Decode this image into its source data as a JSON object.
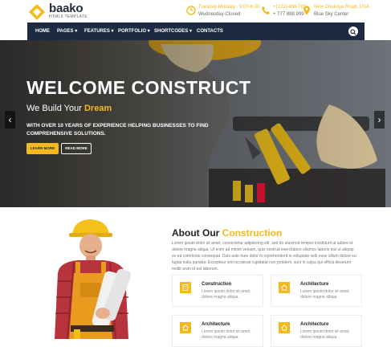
{
  "brand": {
    "name": "baako",
    "tagline": "HTML5 TEMPLATE",
    "accent": "#f5b91e",
    "navy": "#1c2a42"
  },
  "contact": [
    {
      "icon": "clock-icon",
      "line1": "Tuesday-Monday : 9:00-6.00",
      "line2": "Wednesday-Closed"
    },
    {
      "icon": "phone-icon",
      "line1": "+(123) 456-789",
      "line2": "+ 777 888 999"
    },
    {
      "icon": "map-pin-icon",
      "line1": "New Chokoya Road, USA",
      "line2": "Blue Sky Center"
    }
  ],
  "nav": {
    "items": [
      "HOME",
      "PAGES ▾",
      "FEATURES ▾",
      "PORTFOLIO ▾",
      "SHORTCODES ▾",
      "CONTACTS"
    ],
    "search_icon": "search-icon"
  },
  "hero": {
    "title": "WELCOME CONSTRUCT",
    "subtitle_pre": "We Build Your ",
    "subtitle_highlight": "Dream",
    "text": "WITH OVER 10 YEARS OF EXPERIENCE HELPING BUSINESSES TO FIND COMPREHENSIVE SOLUTIONS.",
    "btn_learn": "LEARN MORE",
    "btn_read": "READ MORE",
    "prev": "‹",
    "next": "›"
  },
  "about": {
    "title_pre": "About Our ",
    "title_highlight": "Construction",
    "text": "Lorem ipsum dolor sit amet, consectetur adipisicing elit, sed do eiusmod tempor incididunt ut labore et dolore magna aliqua. Ut enim ad minim veniam, quis nostrud exercitation ullamco laboris nisi ut aliquip ex ea commodo consequat. Duis aute irure dolor in reprehenderit in voluptate velit esse cillum dolore eu fugiat nulla pariatur. Excepteur sint occaecat cupidatat non proident, sunt in culpa qui officia deserunt mollit anim id est laborum.",
    "cards": [
      {
        "title": "Construction",
        "desc": "Lorem ipsum dolor sit amet, dolore magna aliqua."
      },
      {
        "title": "Architecture",
        "desc": "Lorem ipsum dolor sit amet, dolore magna aliqua."
      },
      {
        "title": "Architecture",
        "desc": "Lorem ipsum dolor sit amet, dolore magna aliqua."
      },
      {
        "title": "Architecture",
        "desc": "Lorem ipsum dolor sit amet, dolore magna aliqua."
      }
    ]
  }
}
